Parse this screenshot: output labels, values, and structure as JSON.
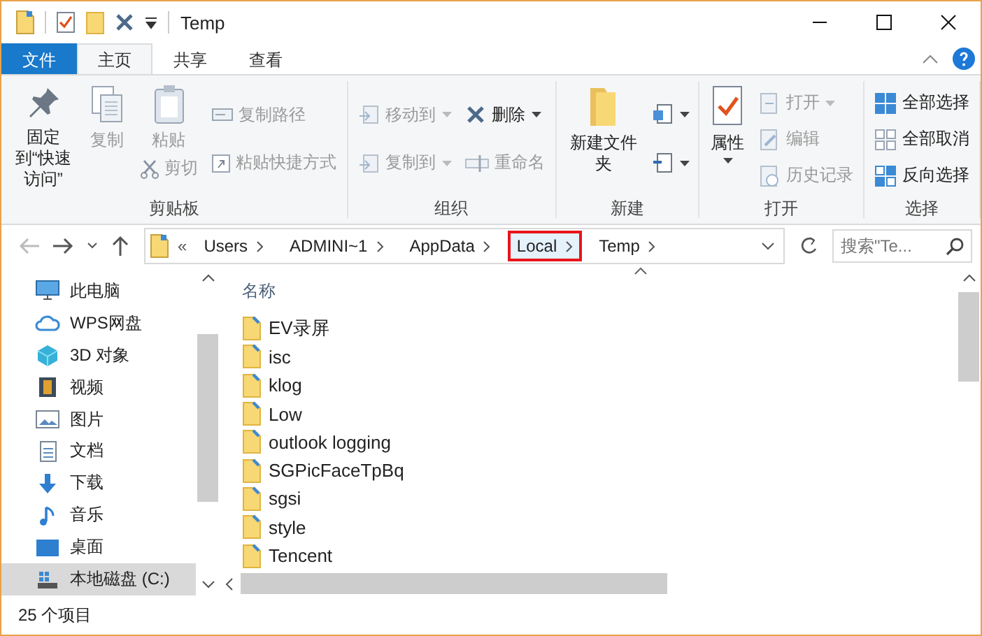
{
  "window": {
    "title": "Temp"
  },
  "ribbon_tabs": [
    {
      "label": "文件",
      "kind": "file"
    },
    {
      "label": "主页",
      "kind": "tab",
      "selected": true
    },
    {
      "label": "共享",
      "kind": "tab",
      "selected": false
    },
    {
      "label": "查看",
      "kind": "tab",
      "selected": false
    }
  ],
  "ribbon": {
    "groups": [
      {
        "label": "剪贴板",
        "columns": [
          [
            {
              "kind": "large",
              "label": "固定到“快速访问”",
              "disabled": false,
              "dropdown": false
            }
          ],
          [
            {
              "kind": "large",
              "label": "复制",
              "disabled": true,
              "dropdown": false
            }
          ],
          [
            {
              "kind": "large",
              "label": "粘贴",
              "disabled": true,
              "dropdown": false
            },
            {
              "kind": "small",
              "label": "剪切",
              "disabled": true,
              "dropdown": false
            }
          ],
          [
            {
              "kind": "small",
              "label": "复制路径",
              "disabled": true,
              "dropdown": false
            },
            {
              "kind": "small",
              "label": "粘贴快捷方式",
              "disabled": true,
              "dropdown": false
            }
          ]
        ]
      },
      {
        "label": "组织",
        "columns": [
          [
            {
              "kind": "small",
              "label": "移动到",
              "disabled": true,
              "dropdown": true
            },
            {
              "kind": "small",
              "label": "复制到",
              "disabled": true,
              "dropdown": true
            }
          ],
          [
            {
              "kind": "small",
              "label": "删除",
              "disabled": false,
              "dropdown": true
            },
            {
              "kind": "small",
              "label": "重命名",
              "disabled": true,
              "dropdown": false
            }
          ]
        ]
      },
      {
        "label": "新建",
        "columns": [
          [
            {
              "kind": "large",
              "label": "新建文件夹",
              "disabled": false,
              "dropdown": false
            }
          ],
          [
            {
              "kind": "icon",
              "disabled": false,
              "dropdown": true
            },
            {
              "kind": "icon",
              "disabled": false,
              "dropdown": true
            }
          ]
        ]
      },
      {
        "label": "打开",
        "columns": [
          [
            {
              "kind": "large",
              "label": "属性",
              "disabled": false,
              "dropdown": true
            }
          ],
          [
            {
              "kind": "small",
              "label": "打开",
              "disabled": true,
              "dropdown": true
            },
            {
              "kind": "small",
              "label": "编辑",
              "disabled": true,
              "dropdown": false
            },
            {
              "kind": "small",
              "label": "历史记录",
              "disabled": true,
              "dropdown": false
            }
          ]
        ]
      },
      {
        "label": "选择",
        "columns": [
          [
            {
              "kind": "small",
              "label": "全部选择",
              "disabled": false,
              "dropdown": false
            },
            {
              "kind": "small",
              "label": "全部取消",
              "disabled": false,
              "dropdown": false
            },
            {
              "kind": "small",
              "label": "反向选择",
              "disabled": false,
              "dropdown": false
            }
          ]
        ]
      }
    ]
  },
  "address_bar": {
    "overflow": "«",
    "crumbs": [
      {
        "label": "Users",
        "highlighted": false
      },
      {
        "label": "ADMINI~1",
        "highlighted": false
      },
      {
        "label": "AppData",
        "highlighted": false
      },
      {
        "label": "Local",
        "highlighted": true
      },
      {
        "label": "Temp",
        "highlighted": false
      }
    ]
  },
  "search": {
    "placeholder": "搜索\"Te..."
  },
  "nav_pane": {
    "items": [
      {
        "label": "此电脑",
        "selected": false
      },
      {
        "label": "WPS网盘",
        "selected": false
      },
      {
        "label": "3D 对象",
        "selected": false
      },
      {
        "label": "视频",
        "selected": false
      },
      {
        "label": "图片",
        "selected": false
      },
      {
        "label": "文档",
        "selected": false
      },
      {
        "label": "下载",
        "selected": false
      },
      {
        "label": "音乐",
        "selected": false
      },
      {
        "label": "桌面",
        "selected": false
      },
      {
        "label": "本地磁盘 (C:)",
        "selected": true
      }
    ]
  },
  "file_list": {
    "columns": [
      "名称"
    ],
    "rows": [
      {
        "name": "EV录屏"
      },
      {
        "name": "isc"
      },
      {
        "name": "klog"
      },
      {
        "name": "Low"
      },
      {
        "name": "outlook logging"
      },
      {
        "name": "SGPicFaceTpBq"
      },
      {
        "name": "sgsi"
      },
      {
        "name": "style"
      },
      {
        "name": "Tencent"
      }
    ]
  },
  "status_bar": {
    "item_count": "25 个项目"
  }
}
